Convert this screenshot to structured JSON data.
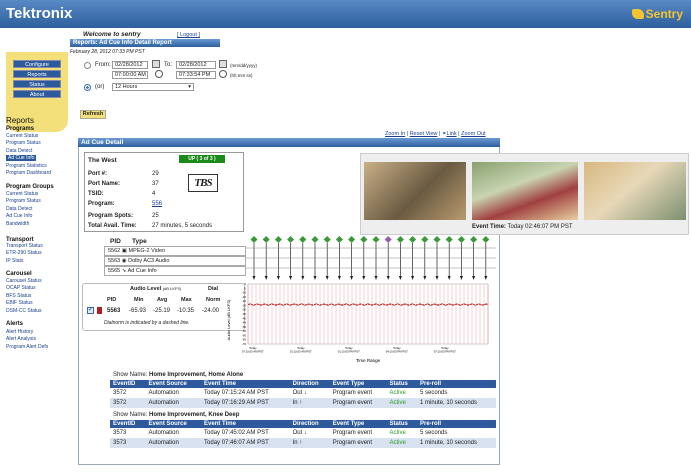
{
  "header": {
    "logo": "Tektronix",
    "product": "Sentry"
  },
  "sidebar": {
    "nav": [
      "Configure",
      "Reports",
      "Status",
      "About"
    ],
    "reports_heading": "Reports",
    "programs_heading": "Programs",
    "programs": [
      "Current Status",
      "Program Status",
      "Data Detect",
      "Ad Cue Info",
      "Program Statistics",
      "Program Dashboard"
    ],
    "groups_heading": "Program Groups",
    "groups": [
      "Current Status",
      "Program Status",
      "Data Detect",
      "Ad Cue Info",
      "Bandwidth"
    ],
    "transport_heading": "Transport",
    "transport": [
      "Transport Status",
      "ETR-290 Status",
      "IP Stats"
    ],
    "carousel_heading": "Carousel",
    "carousel": [
      "Carousel Status",
      "OCAP Status",
      "BFS Status",
      "EBIF Status",
      "DSM-CC Status"
    ],
    "alerts_heading": "Alerts",
    "alerts": [
      "Alert History",
      "Alert Analysis",
      "Program Alert Defs"
    ]
  },
  "main": {
    "welcome": "Welcome to sentry",
    "logout": "[ Logout ]",
    "report_title": "Reports: Ad Cue Info Detail Report",
    "date": "February 28, 2012 07:33 PM PST",
    "from_label": "From:",
    "from_date": "02/28/2012",
    "from_time": "07:00:00 AM",
    "to_label": "To:",
    "to_date": "02/28/2012",
    "to_time": "07:33:54 PM",
    "date_fmt": "(mm/dd/yyyy)",
    "time_fmt": "(hh:mm:ss)",
    "or_label": "(or)",
    "range_select": "12 Hours",
    "refresh": "Refresh",
    "zoom_links": [
      "Zoom In",
      "Reset View",
      "Link",
      "Zoom Out"
    ],
    "panel_title": "Ad Cue Detail"
  },
  "detail": {
    "region": "The West",
    "status": "UP ( 3 of 3 )",
    "port_label": "Port #:",
    "port": "29",
    "portname_label": "Port Name:",
    "portname": "37",
    "tsid_label": "TSID:",
    "tsid": "4",
    "program_label": "Program:",
    "program": "556",
    "spots_label": "Program Spots:",
    "spots": "25",
    "avail_label": "Total Avail. Time:",
    "avail": "27 minutes, 5 seconds",
    "network_logo": "TBS"
  },
  "pids": {
    "pid_hdr": "PID",
    "type_hdr": "Type",
    "rows": [
      {
        "pid": "5562",
        "type": "MPEG-2 Video"
      },
      {
        "pid": "5563",
        "type": "Dolby AC3 Audio"
      },
      {
        "pid": "5565",
        "type": "Ad Cue Info"
      }
    ]
  },
  "audio": {
    "heading": "Audio Level",
    "heading_unit": "(dB LKFS)",
    "dial_heading": "Dial",
    "cols": [
      "PID",
      "Min",
      "Avg",
      "Max",
      "Norm"
    ],
    "row": {
      "pid": "5563",
      "min": "-65.93",
      "avg": "-25.19",
      "max": "-10.35",
      "norm": "-24.00"
    },
    "note": "Dialnorm is indicated by a dashed line."
  },
  "chart_data": {
    "type": "line",
    "ylabel": "Audio Level (dB LKFS)",
    "xlabel": "Time Range",
    "ylim": [
      -70,
      0
    ],
    "yticks": [
      "0",
      "-5",
      "-10",
      "-15",
      "-20",
      "-25",
      "-30",
      "-35",
      "-40",
      "-45",
      "-50",
      "-55",
      "-60",
      "-65",
      "-70"
    ],
    "xticks": [
      "Today\n07:15:00 AM PST",
      "Today\n10:15:00 AM PST",
      "Today\n01:15:00 PM PST",
      "Today\n04:15:00 PM PST",
      "Today\n07:15:00 PM PST"
    ]
  },
  "thumbs": {
    "event_label": "Event Time:",
    "event_time": "Today 02:46:07 PM PST"
  },
  "events": {
    "show_label": "Show Name:",
    "cols": [
      "EventID",
      "Event Source",
      "Event Time",
      "Direction",
      "Event Type",
      "Status",
      "Pre-roll"
    ],
    "groups": [
      {
        "show": "Home Improvement, Home Alone",
        "rows": [
          {
            "id": "3572",
            "src": "Automation",
            "time": "Today 07:15:24 AM PST",
            "dir": "Out",
            "type": "Program event",
            "status": "Active",
            "preroll": "5 seconds"
          },
          {
            "id": "3572",
            "src": "Automation",
            "time": "Today 07:16:29 AM PST",
            "dir": "In",
            "type": "Program event",
            "status": "Active",
            "preroll": "1 minute, 10 seconds"
          }
        ]
      },
      {
        "show": "Home Improvement, Knee Deep",
        "rows": [
          {
            "id": "3573",
            "src": "Automation",
            "time": "Today 07:45:02 AM PST",
            "dir": "Out",
            "type": "Program event",
            "status": "Active",
            "preroll": "5 seconds"
          },
          {
            "id": "3573",
            "src": "Automation",
            "time": "Today 07:46:07 AM PST",
            "dir": "In",
            "type": "Program event",
            "status": "Active",
            "preroll": "1 minute, 10 seconds"
          }
        ]
      }
    ]
  },
  "colors": {
    "brand": "#2d5f9e",
    "active": "#2a9a2a",
    "up": "#1a8a1a",
    "nav_bg": "#f3e07a"
  }
}
